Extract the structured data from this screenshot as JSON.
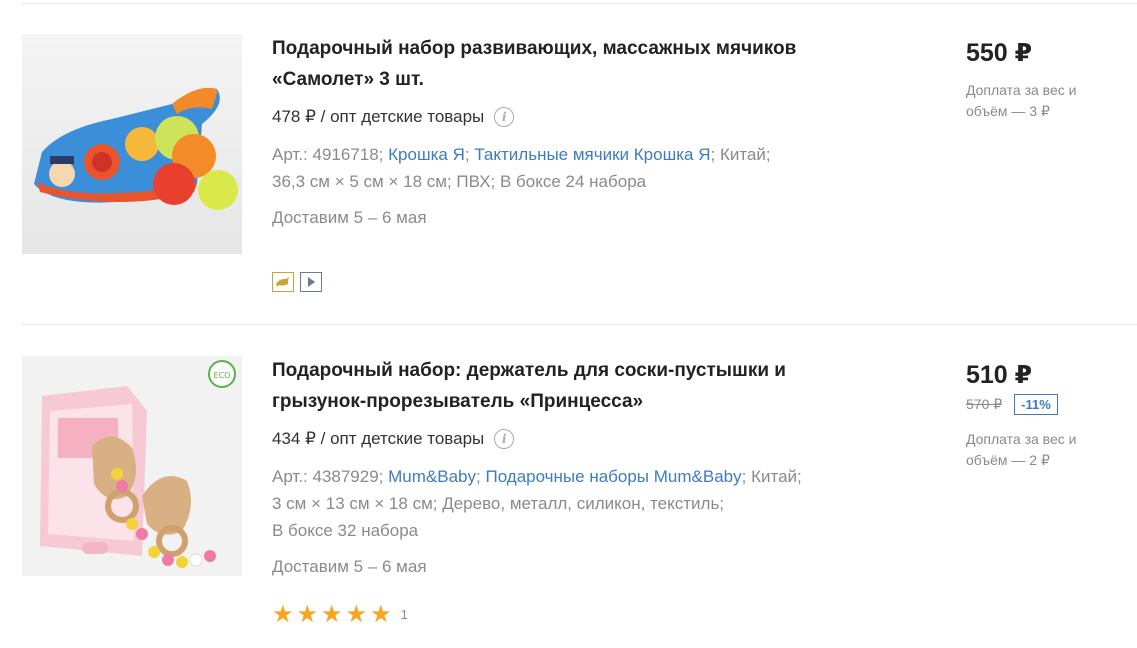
{
  "products": [
    {
      "title": "Подарочный набор развивающих, массажных мячиков «Самолет» 3 шт.",
      "opt_price": "478 ₽ / опт детские товары",
      "article": "Арт.: 4916718;",
      "brand_link": "Крошка Я",
      "category_link": "Тактильные мячики Крошка Я",
      "country": "Китай;",
      "specs": "36,3 см × 5 см × 18 см; ПВХ; В боксе 24 набора",
      "delivery": "Доставим 5 – 6 мая",
      "price": "550 ₽",
      "surcharge": "Доплата за вес и объём — 3 ₽",
      "badges": [
        "dolphin-icon",
        "play-icon"
      ]
    },
    {
      "title": "Подарочный набор: держатель для соски-пустышки и грызунок-прорезыватель «Принцесса»",
      "opt_price": "434 ₽ / опт детские товары",
      "article": "Арт.: 4387929;",
      "brand_link": "Mum&Baby",
      "category_link": "Подарочные наборы Mum&Baby",
      "country": "Китай;",
      "specs": "3 см × 13 см × 18 см; Дерево, металл, силикон, текстиль;",
      "box": "В боксе 32 набора",
      "delivery": "Доставим 5 – 6 мая",
      "price": "510 ₽",
      "old_price": "570 ₽",
      "discount": "-11%",
      "surcharge": "Доплата за вес и объём — 2 ₽",
      "rating_stars": 5,
      "rating_count": "1"
    }
  ],
  "colors": {
    "link": "#3f7bbf",
    "star": "#f5a623",
    "muted": "#8a8a8a"
  }
}
